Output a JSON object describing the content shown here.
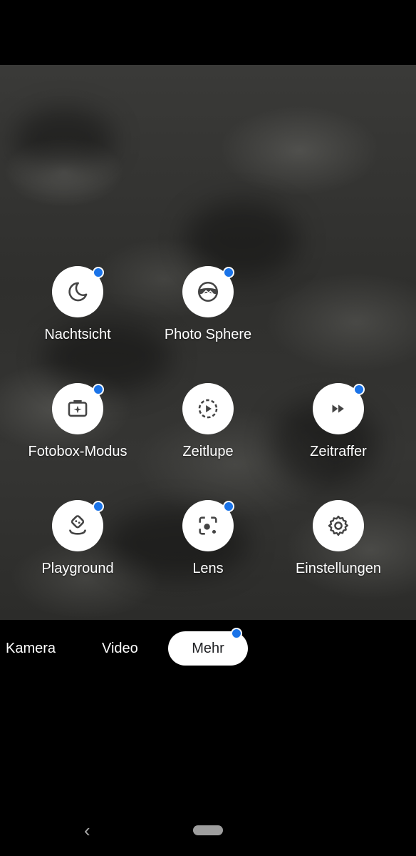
{
  "modes_menu": {
    "items": [
      {
        "label": "Nachtsicht",
        "icon": "moon-icon",
        "new_badge": true
      },
      {
        "label": "Photo Sphere",
        "icon": "photo-sphere-icon",
        "new_badge": true
      },
      {
        "label": "Fotobox-Modus",
        "icon": "photobooth-icon",
        "new_badge": true
      },
      {
        "label": "Zeitlupe",
        "icon": "slow-motion-icon",
        "new_badge": false
      },
      {
        "label": "Zeitraffer",
        "icon": "time-lapse-icon",
        "new_badge": true
      },
      {
        "label": "Playground",
        "icon": "playground-icon",
        "new_badge": true
      },
      {
        "label": "Lens",
        "icon": "lens-icon",
        "new_badge": true
      },
      {
        "label": "Einstellungen",
        "icon": "settings-gear-icon",
        "new_badge": false
      }
    ]
  },
  "mode_tabs": [
    {
      "label": "Kamera",
      "active": false
    },
    {
      "label": "Video",
      "active": false
    },
    {
      "label": "Mehr",
      "active": true,
      "new_badge": true
    }
  ],
  "nav": {
    "back_icon": "back-chevron-icon",
    "home_icon": "home-pill-icon"
  },
  "colors": {
    "badge": "#1a73e8",
    "active_tab_bg": "#ffffff",
    "background": "#000000"
  }
}
